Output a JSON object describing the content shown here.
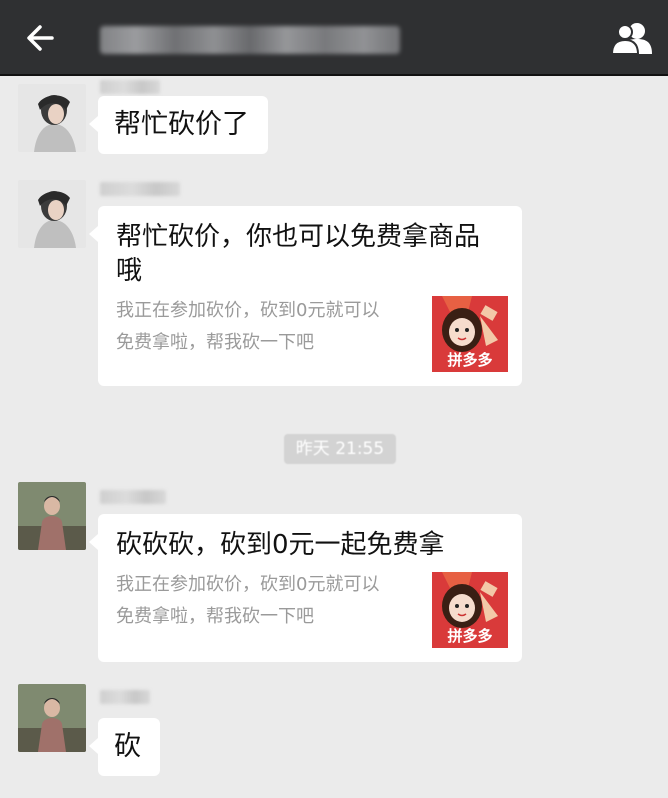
{
  "header": {
    "title": "",
    "back_icon": "arrow-left-icon",
    "group_icon": "group-members-icon",
    "bar_color": "#2f3032"
  },
  "messages": [
    {
      "type": "text",
      "sender": "",
      "text": "帮忙砍价了"
    },
    {
      "type": "card",
      "sender": "",
      "title_line1": "帮忙砍价，你也可以免费拿商品",
      "title_line2": "哦",
      "desc_line1": "我正在参加砍价，砍到0元就可以",
      "desc_line2": "免费拿啦，帮我砍一下吧",
      "thumb_label": "拼多多"
    },
    {
      "type": "time",
      "text": "昨天 21:55"
    },
    {
      "type": "card",
      "sender": "",
      "title_line1": "砍砍砍，砍到0元一起免费拿",
      "desc_line1": "我正在参加砍价，砍到0元就可以",
      "desc_line2": "免费拿啦，帮我砍一下吧",
      "thumb_label": "拼多多"
    },
    {
      "type": "text",
      "sender": "",
      "text": "砍"
    }
  ],
  "colors": {
    "chat_background": "#ebebeb",
    "bubble": "#ffffff",
    "thumb_red": "#d93a3a"
  }
}
